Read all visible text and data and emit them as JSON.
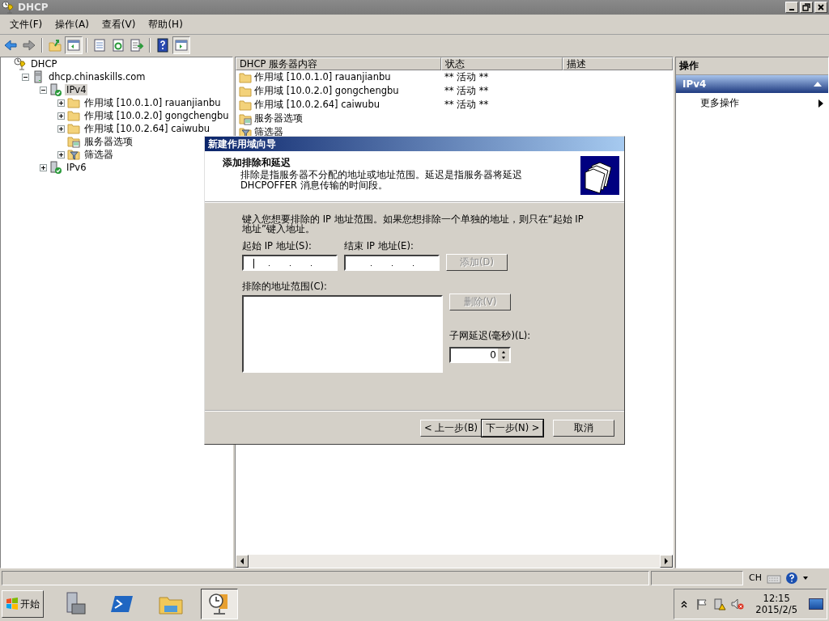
{
  "window": {
    "title": "DHCP"
  },
  "menu": [
    "文件(F)",
    "操作(A)",
    "查看(V)",
    "帮助(H)"
  ],
  "tree": [
    {
      "label": "DHCP",
      "kind": "root",
      "selected": false,
      "children": [
        {
          "label": "dhcp.chinaskills.com",
          "kind": "server",
          "expanded": true,
          "selected": false,
          "children": [
            {
              "label": "IPv4",
              "kind": "protocol",
              "expanded": true,
              "selected": true,
              "children": [
                {
                  "label": "作用域 [10.0.1.0] rauanjianbu",
                  "kind": "folder",
                  "expanded": false,
                  "selected": false
                },
                {
                  "label": "作用域 [10.0.2.0] gongchengbu",
                  "kind": "folder",
                  "expanded": false,
                  "selected": false
                },
                {
                  "label": "作用域 [10.0.2.64] caiwubu",
                  "kind": "folder",
                  "expanded": false,
                  "selected": false
                },
                {
                  "label": "服务器选项",
                  "kind": "options",
                  "selected": false
                },
                {
                  "label": "筛选器",
                  "kind": "filter",
                  "expanded": false,
                  "selected": false
                }
              ]
            },
            {
              "label": "IPv6",
              "kind": "protocol",
              "expanded": false,
              "selected": false
            }
          ]
        }
      ]
    }
  ],
  "list": {
    "columns": [
      "DHCP 服务器内容",
      "状态",
      "描述"
    ],
    "rows": [
      {
        "name": "作用域 [10.0.1.0] rauanjianbu",
        "kind": "folder",
        "status": "** 活动 **"
      },
      {
        "name": "作用域 [10.0.2.0] gongchengbu",
        "kind": "folder",
        "status": "** 活动 **"
      },
      {
        "name": "作用域 [10.0.2.64] caiwubu",
        "kind": "folder",
        "status": "** 活动 **"
      },
      {
        "name": "服务器选项",
        "kind": "options"
      },
      {
        "name": "筛选器",
        "kind": "filter"
      }
    ]
  },
  "actions": {
    "title": "操作",
    "section": "IPv4",
    "items": [
      "更多操作"
    ]
  },
  "dialog": {
    "title": "新建作用域向导",
    "heading": "添加排除和延迟",
    "description": "排除是指服务器不分配的地址或地址范围。延迟是指服务器将延迟 DHCPOFFER 消息传输的时间段。",
    "intro": "键入您想要排除的 IP 地址范围。如果您想排除一个单独的地址，则只在“起始 IP 地址”键入地址。",
    "start_label": "起始 IP 地址(S):",
    "end_label": "结束 IP 地址(E):",
    "add_button": {
      "label": "添加(D)",
      "disabled": true
    },
    "range_label": "排除的地址范围(C):",
    "delete_button": {
      "label": "删除(V)",
      "disabled": true
    },
    "delay_label": "子网延迟(毫秒)(L):",
    "delay_value": "0",
    "buttons": [
      {
        "label": "< 上一步(B)",
        "default": false
      },
      {
        "label": "下一步(N) >",
        "default": true
      },
      {
        "label": "取消",
        "default": false
      }
    ]
  },
  "taskbar": {
    "start": "开始",
    "language": "CH",
    "time": "12:15",
    "date": "2015/2/5"
  }
}
